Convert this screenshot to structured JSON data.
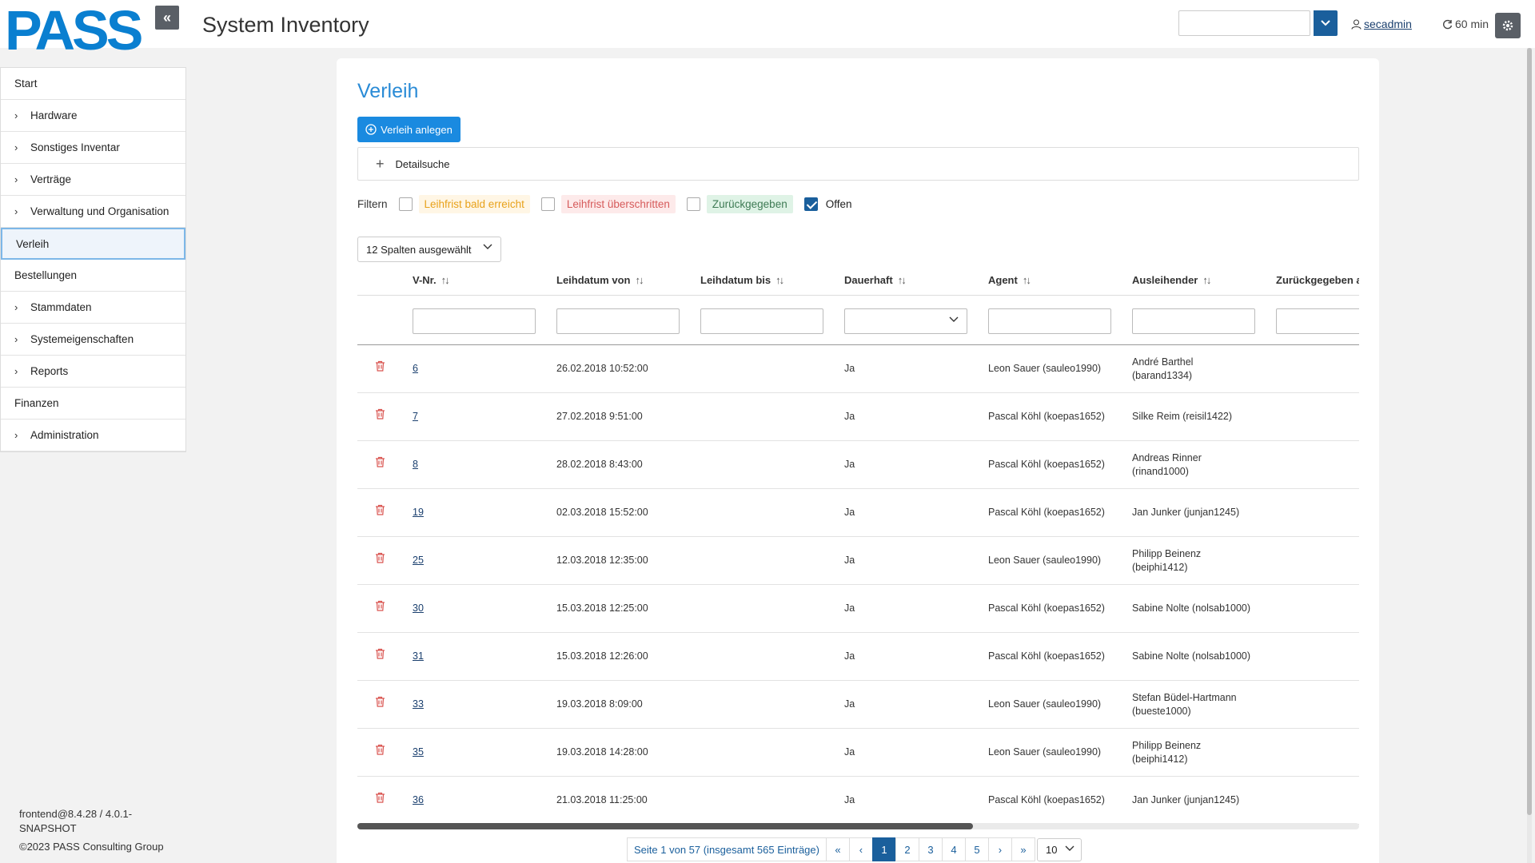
{
  "header": {
    "logo_text": "PASS",
    "title": "System Inventory",
    "user": "secadmin",
    "session": "60 min"
  },
  "sidebar": {
    "items": [
      {
        "label": "Start",
        "expandable": false
      },
      {
        "label": "Hardware",
        "expandable": true
      },
      {
        "label": "Sonstiges Inventar",
        "expandable": true
      },
      {
        "label": "Verträge",
        "expandable": true
      },
      {
        "label": "Verwaltung und Organisation",
        "expandable": true
      },
      {
        "label": "Verleih",
        "expandable": false,
        "active": true
      },
      {
        "label": "Bestellungen",
        "expandable": false
      },
      {
        "label": "Stammdaten",
        "expandable": true
      },
      {
        "label": "Systemeigenschaften",
        "expandable": true
      },
      {
        "label": "Reports",
        "expandable": true
      },
      {
        "label": "Finanzen",
        "expandable": false
      },
      {
        "label": "Administration",
        "expandable": true
      }
    ],
    "version_line1": "frontend@8.4.28 / 4.0.1-",
    "version_line2": "SNAPSHOT",
    "copyright": "©2023 PASS Consulting Group"
  },
  "main": {
    "heading": "Verleih",
    "create_button": "Verleih anlegen",
    "detail_search": "Detailsuche",
    "filter_label": "Filtern",
    "filters": [
      {
        "label": "Leihfrist bald erreicht",
        "checked": false
      },
      {
        "label": "Leihfrist überschritten",
        "checked": false
      },
      {
        "label": "Zurückgegeben",
        "checked": false
      },
      {
        "label": "Offen",
        "checked": true
      }
    ],
    "columns_select": "12 Spalten ausgewählt"
  },
  "table": {
    "headers": [
      "V-Nr.",
      "Leihdatum von",
      "Leihdatum bis",
      "Dauerhaft",
      "Agent",
      "Ausleihender",
      "Zurückgegeben a"
    ],
    "rows": [
      {
        "nr": "6",
        "von": "26.02.2018 10:52:00",
        "bis": "",
        "dauerhaft": "Ja",
        "agent": "Leon Sauer (sauleo1990)",
        "ausleihender1": "André Barthel",
        "ausleihender2": "(barand1334)"
      },
      {
        "nr": "7",
        "von": "27.02.2018 9:51:00",
        "bis": "",
        "dauerhaft": "Ja",
        "agent": "Pascal Köhl (koepas1652)",
        "ausleihender1": "Silke Reim (reisil1422)",
        "ausleihender2": ""
      },
      {
        "nr": "8",
        "von": "28.02.2018 8:43:00",
        "bis": "",
        "dauerhaft": "Ja",
        "agent": "Pascal Köhl (koepas1652)",
        "ausleihender1": "Andreas Rinner",
        "ausleihender2": "(rinand1000)"
      },
      {
        "nr": "19",
        "von": "02.03.2018 15:52:00",
        "bis": "",
        "dauerhaft": "Ja",
        "agent": "Pascal Köhl (koepas1652)",
        "ausleihender1": "Jan Junker (junjan1245)",
        "ausleihender2": ""
      },
      {
        "nr": "25",
        "von": "12.03.2018 12:35:00",
        "bis": "",
        "dauerhaft": "Ja",
        "agent": "Leon Sauer (sauleo1990)",
        "ausleihender1": "Philipp Beinenz",
        "ausleihender2": "(beiphi1412)"
      },
      {
        "nr": "30",
        "von": "15.03.2018 12:25:00",
        "bis": "",
        "dauerhaft": "Ja",
        "agent": "Pascal Köhl (koepas1652)",
        "ausleihender1": "Sabine Nolte (nolsab1000)",
        "ausleihender2": ""
      },
      {
        "nr": "31",
        "von": "15.03.2018 12:26:00",
        "bis": "",
        "dauerhaft": "Ja",
        "agent": "Pascal Köhl (koepas1652)",
        "ausleihender1": "Sabine Nolte (nolsab1000)",
        "ausleihender2": ""
      },
      {
        "nr": "33",
        "von": "19.03.2018 8:09:00",
        "bis": "",
        "dauerhaft": "Ja",
        "agent": "Leon Sauer (sauleo1990)",
        "ausleihender1": "Stefan Büdel-Hartmann",
        "ausleihender2": "(bueste1000)"
      },
      {
        "nr": "35",
        "von": "19.03.2018 14:28:00",
        "bis": "",
        "dauerhaft": "Ja",
        "agent": "Leon Sauer (sauleo1990)",
        "ausleihender1": "Philipp Beinenz",
        "ausleihender2": "(beiphi1412)"
      },
      {
        "nr": "36",
        "von": "21.03.2018 11:25:00",
        "bis": "",
        "dauerhaft": "Ja",
        "agent": "Pascal Köhl (koepas1652)",
        "ausleihender1": "Jan Junker (junjan1245)",
        "ausleihender2": ""
      }
    ]
  },
  "pagination": {
    "info": "Seite 1 von 57 (insgesamt 565 Einträge)",
    "pages": [
      "1",
      "2",
      "3",
      "4",
      "5"
    ],
    "current": "1",
    "page_size": "10"
  },
  "colors": {
    "brand": "#0a7fd0",
    "primary": "#1a8ae0",
    "dark_blue": "#1a5f9c",
    "danger": "#d9534f"
  }
}
